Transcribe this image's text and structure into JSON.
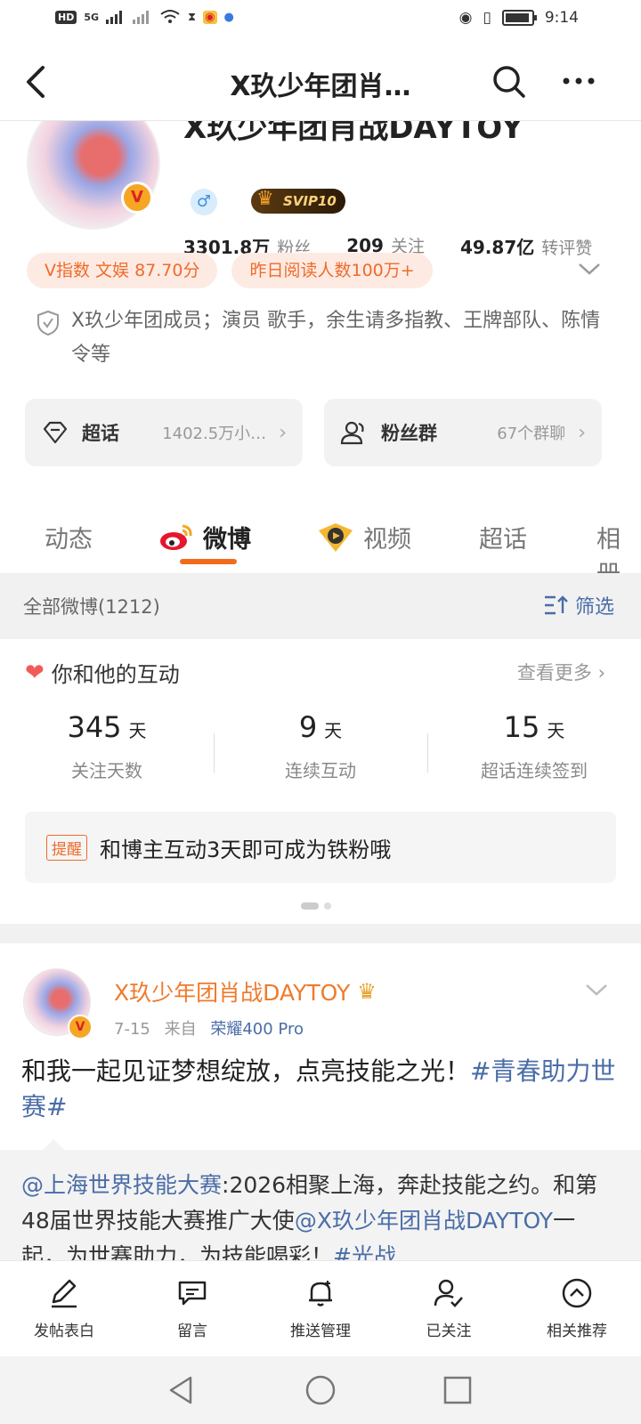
{
  "status_bar": {
    "left_badges": [
      "HD",
      "5G"
    ],
    "time": "9:14"
  },
  "nav": {
    "title": "X玖少年团肖…"
  },
  "profile": {
    "name": "X玖少年团肖战DAYTOY",
    "vip_badge": "SVIP10",
    "stats": [
      {
        "num": "3301.8万",
        "label": "粉丝"
      },
      {
        "num": "209",
        "label": "关注"
      },
      {
        "num": "49.87亿",
        "label": "转评赞"
      }
    ],
    "tags": [
      "V指数 文娱 87.70分",
      "昨日阅读人数100万+"
    ],
    "bio": "X玖少年团成员；演员 歌手，余生请多指教、王牌部队、陈情令等"
  },
  "cards": [
    {
      "title": "超话",
      "sub": "1402.5万小…"
    },
    {
      "title": "粉丝群",
      "sub": "67个群聊"
    }
  ],
  "tabs": [
    "动态",
    "微博",
    "视频",
    "超话",
    "相册"
  ],
  "all_bar": {
    "label": "全部微博(1212)",
    "filter": "筛选"
  },
  "interaction": {
    "title": "你和他的互动",
    "more": "查看更多",
    "stats": [
      {
        "value": "345",
        "unit": "天",
        "caption": "关注天数"
      },
      {
        "value": "9",
        "unit": "天",
        "caption": "连续互动"
      },
      {
        "value": "15",
        "unit": "天",
        "caption": "超话连续签到"
      }
    ],
    "remind_tag": "提醒",
    "remind_text": "和博主互动3天即可成为铁粉哦"
  },
  "post": {
    "author": "X玖少年团肖战DAYTOY",
    "date": "7-15",
    "from_label": "来自",
    "source": "荣耀400 Pro",
    "text": "和我一起见证梦想绽放，点亮技能之光！",
    "hashtag": "#青春助力世赛#",
    "repost_mention": "@上海世界技能大赛",
    "repost_text_1": ":2026相聚上海，奔赴技能之约。和第48届世界技能大赛推广大使",
    "repost_mention_2": "@X玖少年团肖战DAYTOY",
    "repost_text_2": "一起，为世赛助力，为技能喝彩！",
    "repost_hashtag": "#光战"
  },
  "actions": [
    "发帖表白",
    "留言",
    "推送管理",
    "已关注",
    "相关推荐"
  ],
  "colors": {
    "accent": "#f26b1d",
    "link": "#4a6da7",
    "tag_bg": "#fdebe3"
  }
}
